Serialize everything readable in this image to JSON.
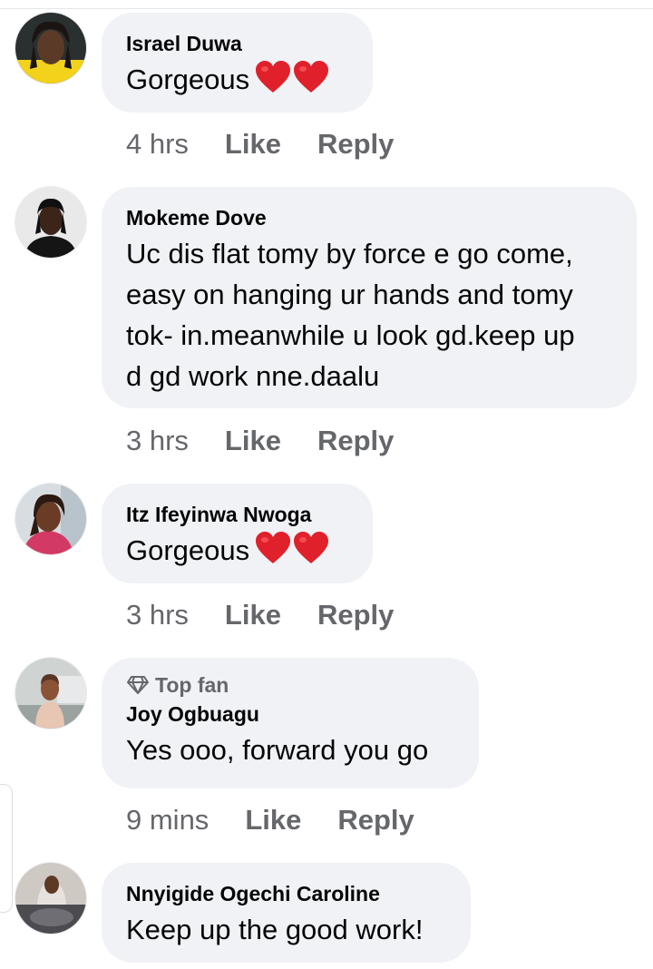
{
  "comments": [
    {
      "author": "Israel Duwa",
      "text": "Gorgeous",
      "hearts": 2,
      "time": "4 hrs",
      "like_label": "Like",
      "reply_label": "Reply"
    },
    {
      "author": "Mokeme Dove",
      "text_lines": [
        "Uc dis flat tomy by force e go come,",
        "easy on hanging ur hands and tomy",
        "tok- in.meanwhile u look gd.keep up",
        "d gd work nne.daalu"
      ],
      "time": "3 hrs",
      "like_label": "Like",
      "reply_label": "Reply"
    },
    {
      "author": "Itz Ifeyinwa Nwoga",
      "text": "Gorgeous",
      "hearts": 2,
      "time": "3 hrs",
      "like_label": "Like",
      "reply_label": "Reply"
    },
    {
      "badge": "Top fan",
      "badge_icon": "diamond-icon",
      "author": "Joy Ogbuagu",
      "text": "Yes ooo, forward you go",
      "time": "9 mins",
      "like_label": "Like",
      "reply_label": "Reply"
    },
    {
      "author": "Nnyigide Ogechi Caroline",
      "text": "Keep up the good work!"
    }
  ],
  "colors": {
    "bubble_bg": "#f0f2f5",
    "meta_text": "#65676b",
    "heart_red": "#e0202b",
    "primary_text": "#050505"
  }
}
